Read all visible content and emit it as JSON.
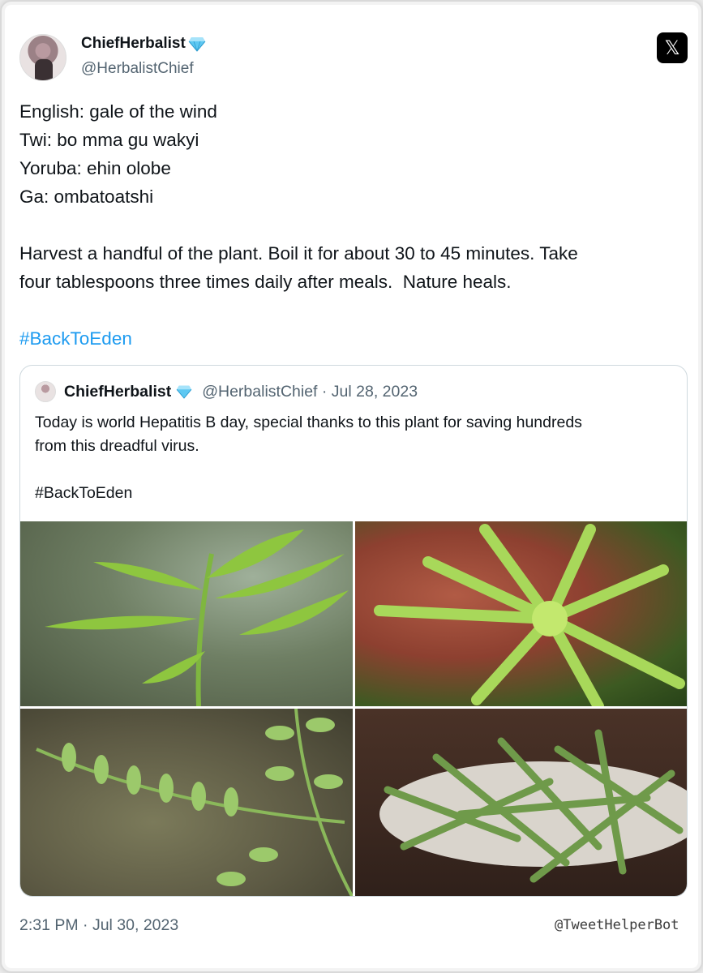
{
  "post": {
    "author_name": "ChiefHerbalist",
    "author_handle": "@HerbalistChief",
    "verified_badge": "diamond-icon",
    "platform_logo": "𝕏",
    "lines": [
      "English: gale of the wind",
      "Twi: bo mma gu wakyi",
      "Yoruba: ehin olobe",
      "Ga: ombatoatshi"
    ],
    "body_lines": [
      "Harvest a handful of the plant. Boil it for about 30 to 45 minutes. Take",
      "four tablespoons three times daily after meals.  Nature heals."
    ],
    "hashtag": "#BackToEden",
    "timestamp": "2:31 PM · Jul 30, 2023"
  },
  "quoted": {
    "author_name": "ChiefHerbalist",
    "author_handle": "@HerbalistChief · Jul 28, 2023",
    "text_lines": [
      "Today is world Hepatitis B day, special thanks to this plant for saving hundreds",
      "from this dreadful virus."
    ],
    "hashtag": "#BackToEden"
  },
  "watermark": "@TweetHelperBot",
  "colors": {
    "link": "#1d9bf0",
    "secondary_text": "#536471",
    "primary_text": "#0f1419",
    "badge": "#5ec8f2"
  }
}
